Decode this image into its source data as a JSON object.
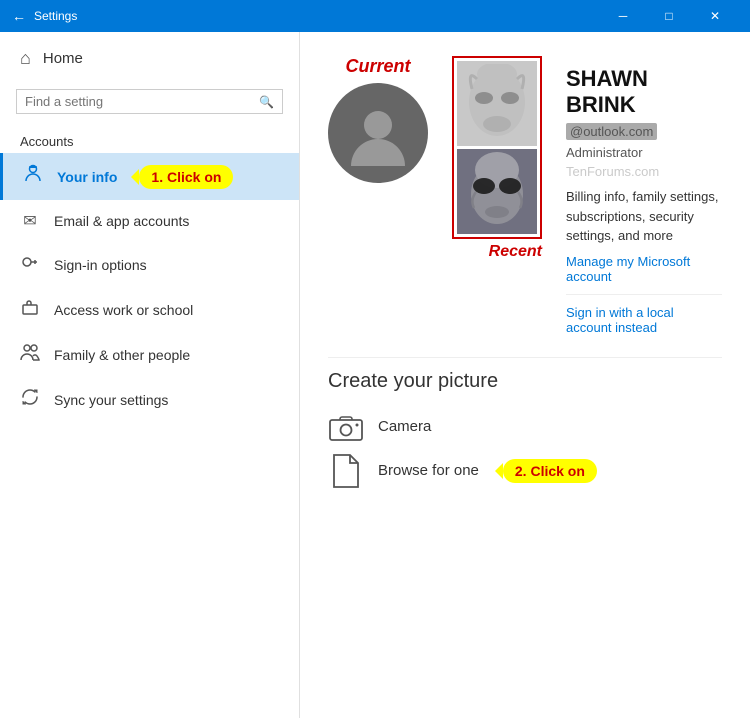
{
  "titlebar": {
    "back_icon": "←",
    "title": "Settings",
    "minimize": "─",
    "maximize": "□",
    "close": "✕"
  },
  "sidebar": {
    "home_label": "Home",
    "search_placeholder": "Find a setting",
    "section_label": "Accounts",
    "nav_items": [
      {
        "id": "your-info",
        "label": "Your info",
        "icon": "👤",
        "active": true
      },
      {
        "id": "email-accounts",
        "label": "Email & app accounts",
        "icon": "✉"
      },
      {
        "id": "sign-in",
        "label": "Sign-in options",
        "icon": "🔑"
      },
      {
        "id": "access-work",
        "label": "Access work or school",
        "icon": "💼"
      },
      {
        "id": "family",
        "label": "Family & other people",
        "icon": "👥"
      },
      {
        "id": "sync",
        "label": "Sync your settings",
        "icon": "🔄"
      }
    ],
    "callout1_text": "1. Click on"
  },
  "content": {
    "current_label": "Current",
    "recent_label": "Recent",
    "profile_name": "SHAWN BRINK",
    "profile_email": "@outlook.com",
    "profile_role": "Administrator",
    "watermark": "TenForums.com",
    "description": "Billing info, family settings, subscriptions, security settings, and more",
    "manage_link": "Manage my Microsoft account",
    "sign_in_local_link": "Sign in with a local account instead",
    "create_picture_title": "Create your picture",
    "camera_label": "Camera",
    "browse_label": "Browse for one",
    "callout2_text": "2. Click on"
  }
}
